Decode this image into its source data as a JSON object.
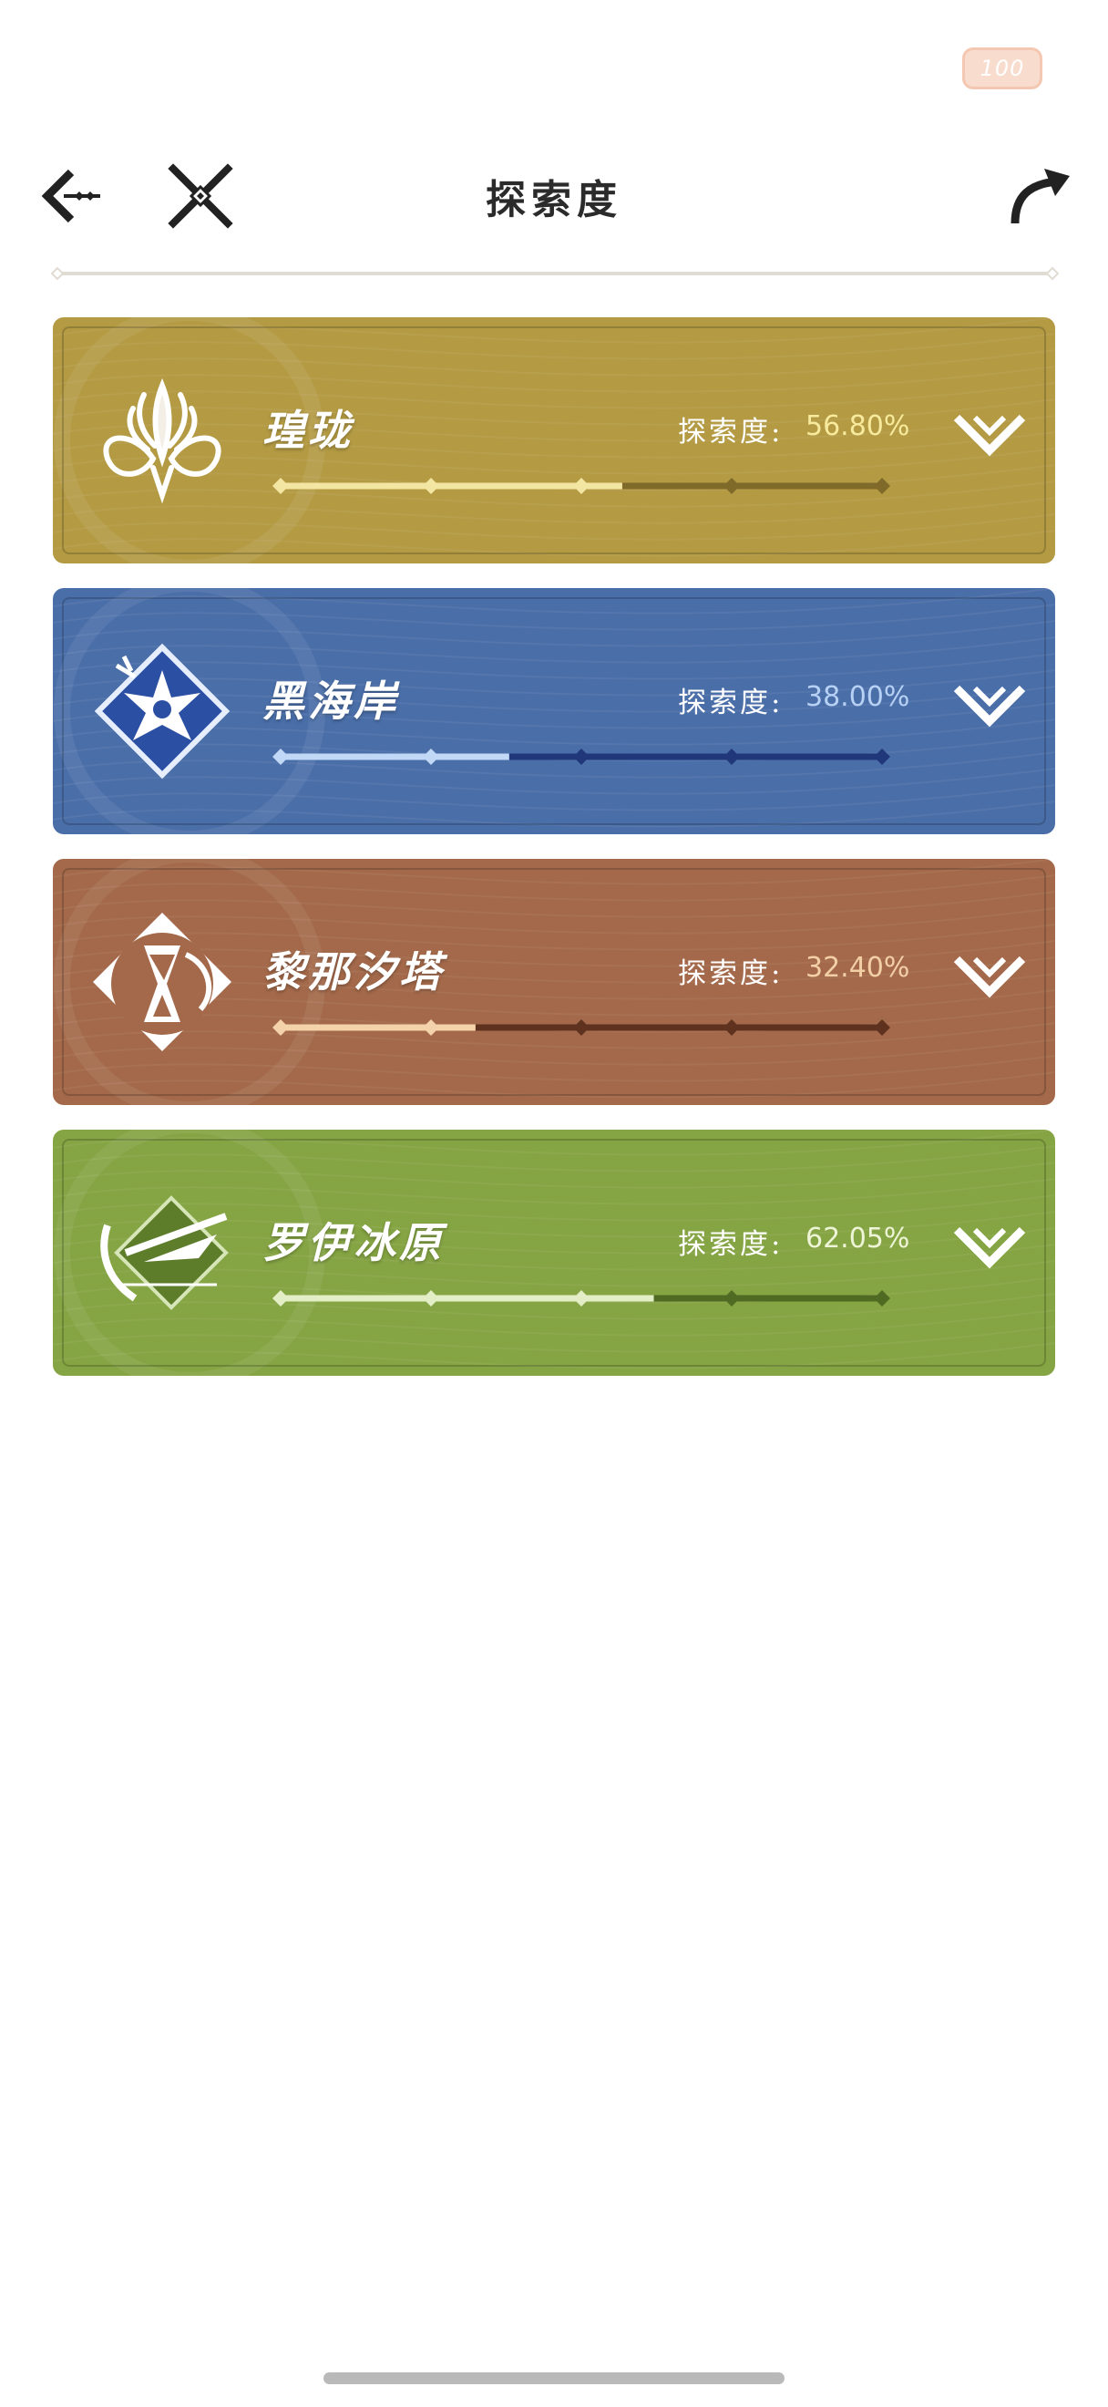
{
  "status": {
    "badge_value": "100"
  },
  "header": {
    "title": "探索度"
  },
  "regions": [
    {
      "name": "瑝珑",
      "label": "探索度:",
      "value_text": "56.80%",
      "progress": 0.568,
      "colors": {
        "bg": "#b39a43",
        "filled": "#f3e6a2",
        "empty": "#7f6a2a",
        "value": "#f7ea9c"
      },
      "emblem_icon": "dragon-emblem-icon"
    },
    {
      "name": "黑海岸",
      "label": "探索度:",
      "value_text": "38.00%",
      "progress": 0.38,
      "colors": {
        "bg": "#4a6ea8",
        "filled": "#c2d8f7",
        "empty": "#20387a",
        "value": "#b7d1f5"
      },
      "emblem_icon": "star-flower-emblem-icon"
    },
    {
      "name": "黎那汐塔",
      "label": "探索度:",
      "value_text": "32.40%",
      "progress": 0.324,
      "colors": {
        "bg": "#a3694a",
        "filled": "#f4d3aa",
        "empty": "#5f3220",
        "value": "#f3cfa6"
      },
      "emblem_icon": "hourglass-emblem-icon"
    },
    {
      "name": "罗伊冰原",
      "label": "探索度:",
      "value_text": "62.05%",
      "progress": 0.6205,
      "colors": {
        "bg": "#85a443",
        "filled": "#e3eec6",
        "empty": "#4f6a22",
        "value": "#eef5d6"
      },
      "emblem_icon": "ice-spear-emblem-icon"
    }
  ]
}
